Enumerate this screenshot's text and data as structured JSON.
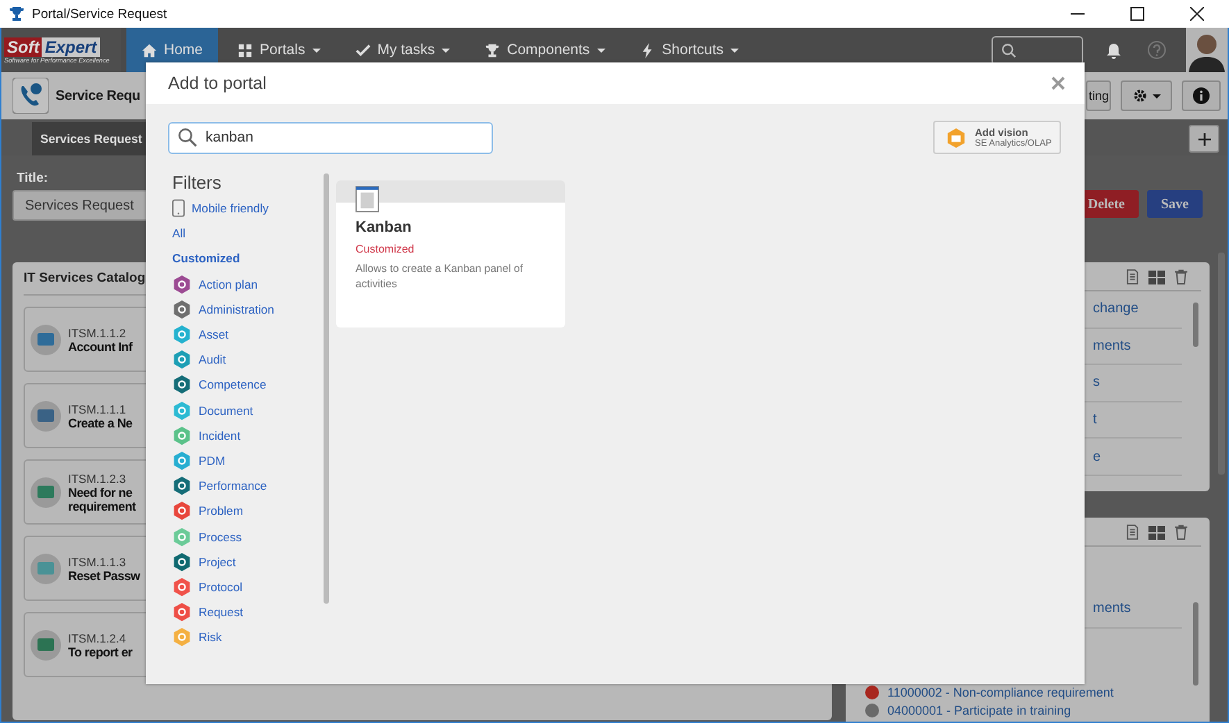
{
  "window": {
    "title": "Portal/Service Request"
  },
  "nav": {
    "logo": {
      "brand_left": "Soft",
      "brand_right": "Expert",
      "tagline": "Software for Performance Excellence"
    },
    "items": [
      {
        "label": "Home",
        "kind": "home",
        "menu": false,
        "selected": true
      },
      {
        "label": "Portals",
        "kind": "grid",
        "menu": true,
        "selected": false
      },
      {
        "label": "My tasks",
        "kind": "check",
        "menu": true,
        "selected": false
      },
      {
        "label": "Components",
        "kind": "trophy",
        "menu": true,
        "selected": false
      },
      {
        "label": "Shortcuts",
        "kind": "bolt",
        "menu": true,
        "selected": false
      }
    ]
  },
  "page_header": {
    "title": "Service Requ",
    "partial_button": "ting"
  },
  "tabs": [
    {
      "label": "Services Request",
      "selected": true
    }
  ],
  "form": {
    "title_label": "Title:",
    "title_value": "Services Request",
    "buttons": [
      "Delete",
      "Save"
    ]
  },
  "catalog": {
    "title": "IT Services Catalog",
    "cards": [
      {
        "code": "ITSM.1.1.2",
        "lines": [
          "Account Inf"
        ],
        "color": "#2f6c99"
      },
      {
        "code": "ITSM.1.1.1",
        "lines": [
          "Create a Ne"
        ],
        "color": "#3a6285"
      },
      {
        "code": "ITSM.1.2.3",
        "lines": [
          "Need for ne",
          "requirement"
        ],
        "color": "#2d7a5c"
      },
      {
        "code": "ITSM.1.1.3",
        "lines": [
          "Reset Passw"
        ],
        "color": "#4a9296"
      },
      {
        "code": "ITSM.1.2.4",
        "lines": [
          "To report er"
        ],
        "color": "#2c7353"
      }
    ]
  },
  "side_panels": [
    {
      "rows": [
        {
          "kind": "cut",
          "text": "change"
        },
        {
          "kind": "cut",
          "text": "ments"
        },
        {
          "kind": "cut",
          "text": "s"
        },
        {
          "kind": "cut",
          "text": "t"
        },
        {
          "kind": "cut",
          "text": "e"
        }
      ]
    },
    {
      "rows": [
        {
          "kind": "cut",
          "text": "ments"
        },
        {
          "kind": "full",
          "text": "11000002 - Non-compliance requirement",
          "color": "#a8271f"
        },
        {
          "kind": "full",
          "text": "04000001 - Participate in training",
          "color": "#6a6a6a"
        }
      ]
    }
  ],
  "dialog": {
    "title": "Add to portal",
    "search": {
      "value": "kanban"
    },
    "add_vision": {
      "label": "Add vision",
      "sublabel": "SE Analytics/OLAP"
    },
    "filters": {
      "title": "Filters",
      "mobile_friendly": "Mobile friendly",
      "scopes": [
        {
          "label": "All",
          "selected": false
        },
        {
          "label": "Customized",
          "selected": true
        }
      ],
      "modules": [
        {
          "label": "Action plan",
          "color": "#9c4b93"
        },
        {
          "label": "Administration",
          "color": "#6f6f6f"
        },
        {
          "label": "Asset",
          "color": "#25b2cf"
        },
        {
          "label": "Audit",
          "color": "#1d9fb5"
        },
        {
          "label": "Competence",
          "color": "#156d78"
        },
        {
          "label": "Document",
          "color": "#2cbad3"
        },
        {
          "label": "Incident",
          "color": "#5bc28a"
        },
        {
          "label": "PDM",
          "color": "#27aed1"
        },
        {
          "label": "Performance",
          "color": "#156d78"
        },
        {
          "label": "Problem",
          "color": "#e8463c"
        },
        {
          "label": "Process",
          "color": "#6bcb98"
        },
        {
          "label": "Project",
          "color": "#0f6970"
        },
        {
          "label": "Protocol",
          "color": "#f0524a"
        },
        {
          "label": "Request",
          "color": "#ee4e46"
        },
        {
          "label": "Risk",
          "color": "#f4b042"
        }
      ]
    },
    "results": [
      {
        "title": "Kanban",
        "category": "Customized",
        "description": "Allows to create a Kanban panel of activities"
      }
    ]
  }
}
